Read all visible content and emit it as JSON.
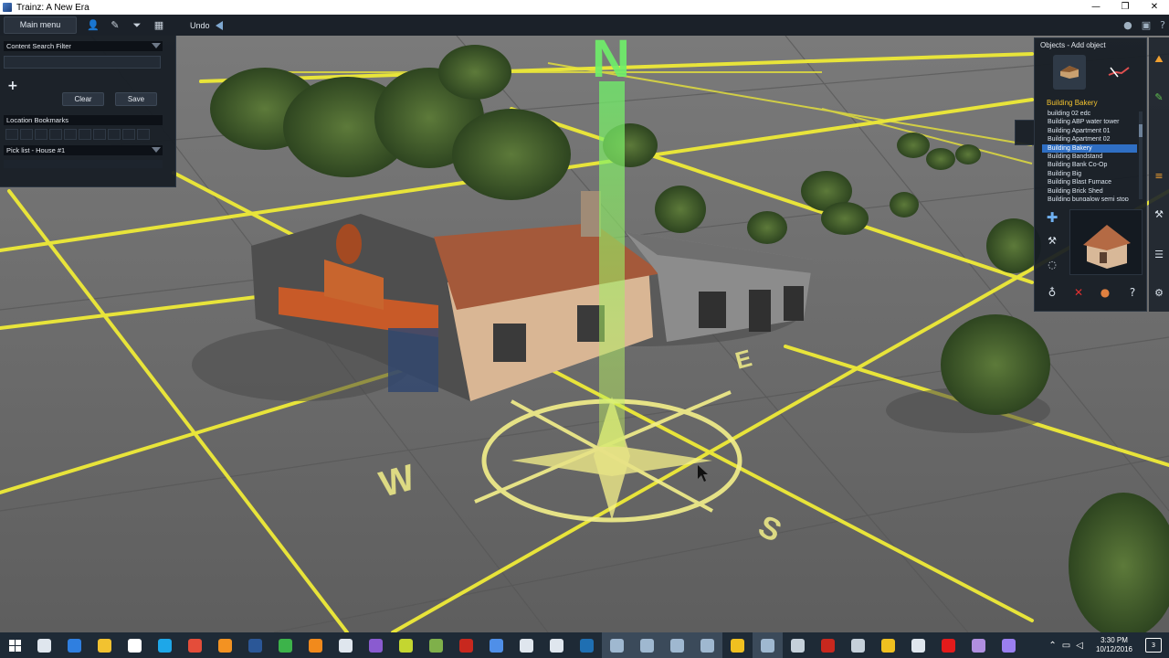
{
  "window": {
    "title": "Trainz: A New Era",
    "controls": [
      "—",
      "❐",
      "✕"
    ]
  },
  "toolbar": {
    "main_menu": "Main menu",
    "undo": "Undo",
    "icons": [
      "person-icon",
      "edit-icon",
      "filter-icon",
      "grid-icon"
    ],
    "right_icons": [
      "status-icon",
      "layout-icon",
      "help-icon"
    ]
  },
  "left_panel": {
    "search_filter": "Content Search Filter",
    "search_value": "",
    "add_symbol": "+",
    "clear": "Clear",
    "save": "Save",
    "location_bookmarks": "Location Bookmarks",
    "pick_list": "Pick list - House #1"
  },
  "right_panel": {
    "title": "Objects - Add object",
    "selected": "Building Bakery",
    "list": [
      "building 02 edc",
      "Building ABP water tower",
      "Building Apartment 01",
      "Building Apartment 02",
      "Building Bakery",
      "Building Bandstand",
      "Building Bank Co-Op",
      "Building Big",
      "Building Blast Furnace",
      "Building Brick Shed",
      "Building bungalow semi stop"
    ],
    "selected_index": 4,
    "side_icons": [
      "plus-icon",
      "wrench-icon",
      "lasso-icon",
      "dropper-icon"
    ],
    "bottom_icons": [
      "delete-icon",
      "info-icon",
      "help-icon"
    ]
  },
  "scene": {
    "compass": {
      "north": "N",
      "east": "E",
      "south": "S",
      "west": "W"
    },
    "colors": {
      "grid": "#e8e43a",
      "ground": "#6b6b6b",
      "compass": "#f4f08a",
      "north_beam": "#6ff06a"
    }
  },
  "taskbar": {
    "time": "3:30 PM",
    "date": "10/12/2016",
    "notifications": "3",
    "apps": [
      {
        "name": "task-view-icon",
        "color": "#dfe6ee"
      },
      {
        "name": "edge-icon",
        "color": "#2f7fe0"
      },
      {
        "name": "explorer-icon",
        "color": "#f2c230"
      },
      {
        "name": "store-icon",
        "color": "#ffffff"
      },
      {
        "name": "skype-icon",
        "color": "#1ea7e8"
      },
      {
        "name": "chrome-icon",
        "color": "#e44d3a"
      },
      {
        "name": "firefox-icon",
        "color": "#f39222"
      },
      {
        "name": "word-icon",
        "color": "#2b5797"
      },
      {
        "name": "app-icon",
        "color": "#3cb34a"
      },
      {
        "name": "vlc-icon",
        "color": "#f18a1c"
      },
      {
        "name": "calculator-icon",
        "color": "#dfe6ee"
      },
      {
        "name": "visualstudio-icon",
        "color": "#8a5bd0"
      },
      {
        "name": "script-icon",
        "color": "#c4d630"
      },
      {
        "name": "notepad-icon",
        "color": "#7fb04a"
      },
      {
        "name": "filezilla-icon",
        "color": "#c8281e"
      },
      {
        "name": "window-icon",
        "color": "#4f8fe8"
      },
      {
        "name": "unity-icon",
        "color": "#dfe6ee"
      },
      {
        "name": "unity-icon-2",
        "color": "#dfe6ee"
      },
      {
        "name": "photoshop-icon",
        "color": "#1f6fb2"
      },
      {
        "name": "trainz-icon",
        "color": "#9fb8d0"
      },
      {
        "name": "trainz-icon-2",
        "color": "#9fb8d0"
      },
      {
        "name": "trainz-icon-3",
        "color": "#9fb8d0"
      },
      {
        "name": "trainz-icon-4",
        "color": "#9fb8d0"
      },
      {
        "name": "train-icon",
        "color": "#f0c020"
      },
      {
        "name": "trainz-icon-5",
        "color": "#9fb8d0"
      },
      {
        "name": "steam-icon",
        "color": "#c5d0da"
      },
      {
        "name": "recorder-icon",
        "color": "#c8281e"
      },
      {
        "name": "phone-icon",
        "color": "#c5d0da"
      },
      {
        "name": "archive-icon",
        "color": "#f0c020"
      },
      {
        "name": "terminal-icon",
        "color": "#dfe6ee"
      },
      {
        "name": "record-icon",
        "color": "#e31b1b"
      },
      {
        "name": "game-icon",
        "color": "#b08fe0"
      },
      {
        "name": "aftereffects-icon",
        "color": "#9a7ff0"
      }
    ],
    "active_indices": [
      19,
      20,
      21,
      22,
      24
    ]
  }
}
